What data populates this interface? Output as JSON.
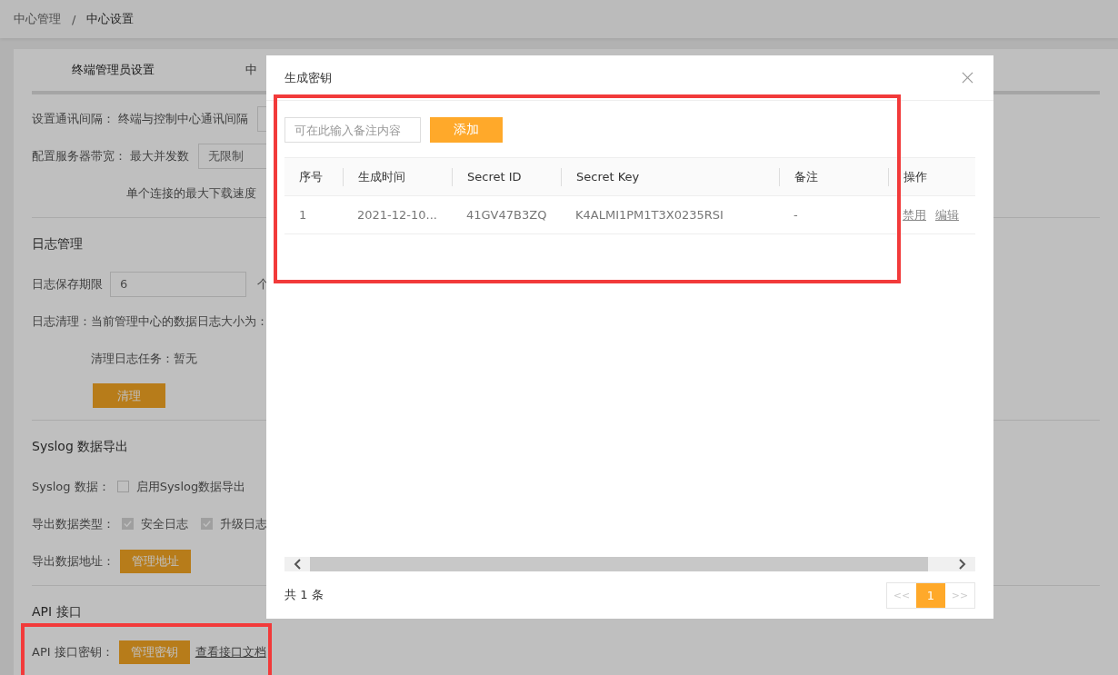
{
  "breadcrumb": [
    {
      "label": "中心管理"
    },
    {
      "label": "中心设置"
    }
  ],
  "breadcrumb_separator": "/",
  "tabs": [
    {
      "label": "终端管理员设置",
      "selected": true
    },
    {
      "label": "中",
      "selected": false
    }
  ],
  "settings": {
    "interval_label": "设置通讯间隔：",
    "interval_sub": "终端与控制中心通讯间隔",
    "bandwidth_label": "配置服务器带宽：",
    "concurrency_label": "最大并发数",
    "concurrency_value": "无限制",
    "speed_label": "单个连接的最大下载速度"
  },
  "log": {
    "title": "日志管理",
    "retention_label": "日志保存期限",
    "retention_value": "6",
    "retention_unit": "个",
    "cleanup_label": "日志清理：当前管理中心的数据日志大小为：",
    "task_label": "清理日志任务：暂无",
    "clean_button": "清理"
  },
  "syslog": {
    "title": "Syslog 数据导出",
    "data_label": "Syslog 数据：",
    "options": [
      {
        "label": "启用Syslog数据导出",
        "checked": false,
        "disabled": false
      }
    ],
    "type_label": "导出数据类型：",
    "types": [
      {
        "label": "安全日志",
        "checked": true,
        "disabled": true
      },
      {
        "label": "升级日志",
        "checked": true,
        "disabled": true
      }
    ],
    "address_label": "导出数据地址：",
    "address_button": "管理地址"
  },
  "api": {
    "title": "API 接口",
    "key_label": "API 接口密钥：",
    "key_button": "管理密钥",
    "doc_link": "查看接口文档"
  },
  "dialog": {
    "title": "生成密钥",
    "note_placeholder": "可在此输入备注内容",
    "add_button": "添加",
    "columns": [
      "序号",
      "生成时间",
      "Secret ID",
      "Secret Key",
      "备注",
      "操作"
    ],
    "rows": [
      {
        "cells": [
          "1",
          "2021-12-10...",
          "41GV47B3ZQ",
          "K4ALMI1PM1T3X0235RSI",
          "-"
        ],
        "actions": [
          "禁用",
          "编辑"
        ]
      }
    ],
    "total": "共 1 条",
    "pagination": {
      "prev": "<<",
      "next": ">>",
      "pages": [
        {
          "label": "1",
          "selected": true
        }
      ]
    }
  }
}
